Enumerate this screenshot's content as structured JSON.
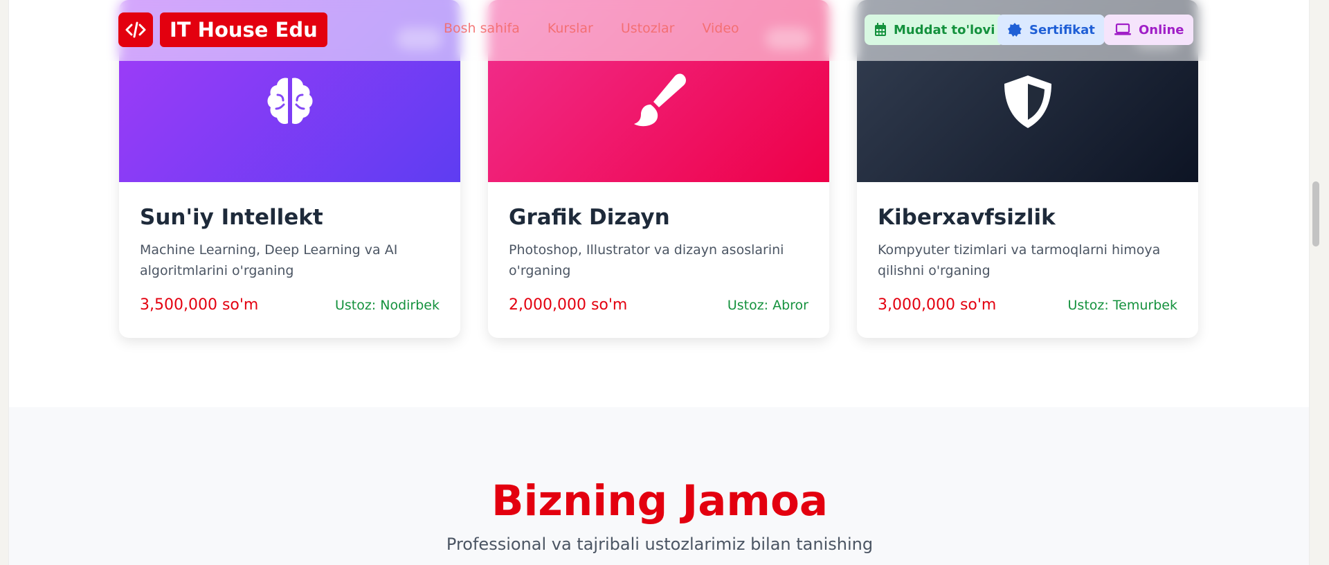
{
  "header": {
    "brand": "IT House Edu",
    "nav": [
      "Bosh sahifa",
      "Kurslar",
      "Ustozlar",
      "Video"
    ],
    "pills": {
      "installment": "Muddat to'lovi",
      "certificate": "Sertifikat",
      "online": "Online"
    }
  },
  "courses": [
    {
      "title": "Sun'iy Intellekt",
      "desc": "Machine Learning, Deep Learning va AI algoritmlarini o'rganing",
      "price": "3,500,000 so'm",
      "teacher": "Ustoz: Nodirbek",
      "icon": "brain-icon"
    },
    {
      "title": "Grafik Dizayn",
      "desc": "Photoshop, Illustrator va dizayn asoslarini o'rganing",
      "price": "2,000,000 so'm",
      "teacher": "Ustoz: Abror",
      "icon": "paint-brush-icon"
    },
    {
      "title": "Kiberxavfsizlik",
      "desc": "Kompyuter tizimlari va tarmoqlarni himoya qilishni o'rganing",
      "price": "3,000,000 so'm",
      "teacher": "Ustoz: Temurbek",
      "icon": "shield-icon"
    }
  ],
  "team": {
    "title": "Bizning Jamoa",
    "subtitle": "Professional va tajribali ustozlarimiz bilan tanishing"
  },
  "colors": {
    "brand_red": "#e3000f",
    "teacher_green": "#14913d"
  }
}
